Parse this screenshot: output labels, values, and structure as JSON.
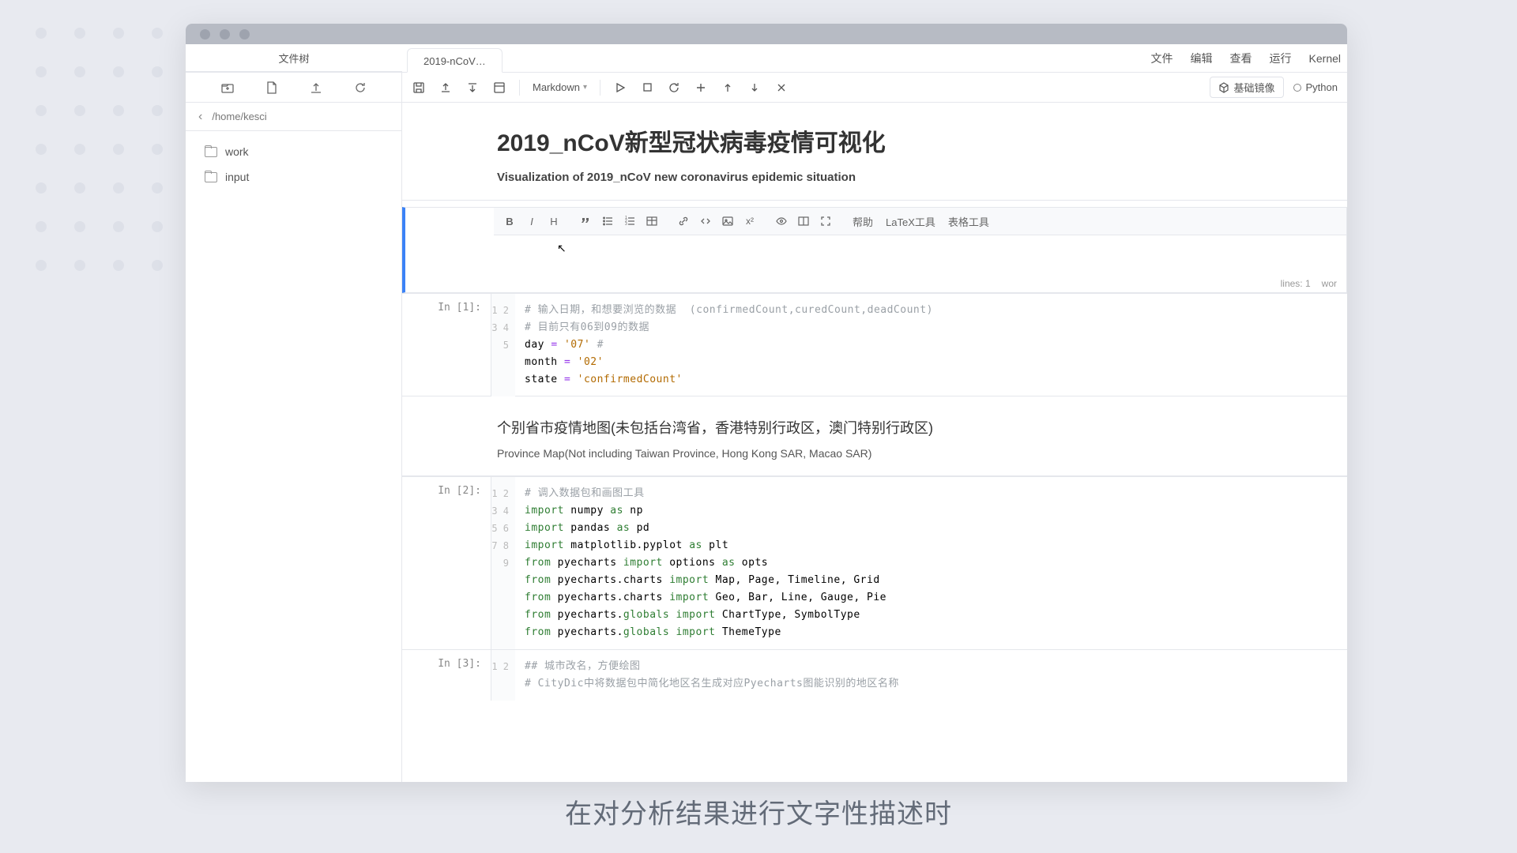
{
  "sidebar": {
    "header": "文件树",
    "path": "/home/kesci",
    "folders": [
      "work",
      "input"
    ]
  },
  "tab": {
    "label": "2019-nCoV…"
  },
  "menubar": {
    "items": [
      "文件",
      "编辑",
      "查看",
      "运行",
      "Kernel"
    ]
  },
  "toolbar": {
    "cell_type": "Markdown",
    "env_label": "基础镜像",
    "kernel_label": "Python"
  },
  "doc": {
    "title": "2019_nCoV新型冠状病毒疫情可视化",
    "subtitle": "Visualization of 2019_nCoV new coronavirus epidemic situation"
  },
  "editor_toolbar": {
    "bold": "B",
    "italic": "I",
    "heading": "H",
    "help": "帮助",
    "latex": "LaTeX工具",
    "table": "表格工具"
  },
  "editor_status": {
    "lines": "lines: 1",
    "words": "wor"
  },
  "cells": [
    {
      "prompt": "In [1]:",
      "lines": [
        {
          "n": "1",
          "html": "<span class='tok-comment'># 输入日期，和想要浏览的数据  (confirmedCount,curedCount,deadCount)</span>"
        },
        {
          "n": "2",
          "html": "<span class='tok-comment'># 目前只有06到09的数据</span>"
        },
        {
          "n": "3",
          "html": "day <span class='tok-op'>=</span> <span class='tok-string'>'07'</span> <span class='tok-comment'>#</span>"
        },
        {
          "n": "4",
          "html": "month <span class='tok-op'>=</span> <span class='tok-string'>'02'</span>"
        },
        {
          "n": "5",
          "html": "state <span class='tok-op'>=</span> <span class='tok-string'>'confirmedCount'</span>"
        }
      ]
    },
    {
      "md_title": "个别省市疫情地图(未包括台湾省，香港特别行政区，澳门特别行政区)",
      "md_sub": "Province Map(Not including Taiwan Province, Hong Kong SAR, Macao SAR)"
    },
    {
      "prompt": "In [2]:",
      "lines": [
        {
          "n": "1",
          "html": "<span class='tok-comment'># 调入数据包和画图工具</span>"
        },
        {
          "n": "2",
          "html": "<span class='tok-import'>import</span> numpy <span class='tok-as'>as</span> np"
        },
        {
          "n": "3",
          "html": "<span class='tok-import'>import</span> pandas <span class='tok-as'>as</span> pd"
        },
        {
          "n": "4",
          "html": "<span class='tok-import'>import</span> matplotlib.pyplot <span class='tok-as'>as</span> plt"
        },
        {
          "n": "5",
          "html": "<span class='tok-from'>from</span> pyecharts <span class='tok-import'>import</span> options <span class='tok-as'>as</span> opts"
        },
        {
          "n": "6",
          "html": "<span class='tok-from'>from</span> pyecharts.charts <span class='tok-import'>import</span> Map, Page, Timeline, Grid"
        },
        {
          "n": "7",
          "html": "<span class='tok-from'>from</span> pyecharts.charts <span class='tok-import'>import</span> Geo, Bar, Line, Gauge, Pie"
        },
        {
          "n": "8",
          "html": "<span class='tok-from'>from</span> pyecharts.<span class='tok-mod'>globals</span> <span class='tok-import'>import</span> ChartType, SymbolType"
        },
        {
          "n": "9",
          "html": "<span class='tok-from'>from</span> pyecharts.<span class='tok-mod'>globals</span> <span class='tok-import'>import</span> ThemeType"
        }
      ]
    },
    {
      "prompt": "In [3]:",
      "lines": [
        {
          "n": "1",
          "html": "<span class='tok-comment'>## 城市改名，方便绘图</span>"
        },
        {
          "n": "2",
          "html": "<span class='tok-comment'># CityDic中将数据包中简化地区名生成对应Pyecharts图能识别的地区名称</span>"
        }
      ]
    }
  ],
  "caption": "在对分析结果进行文字性描述时"
}
